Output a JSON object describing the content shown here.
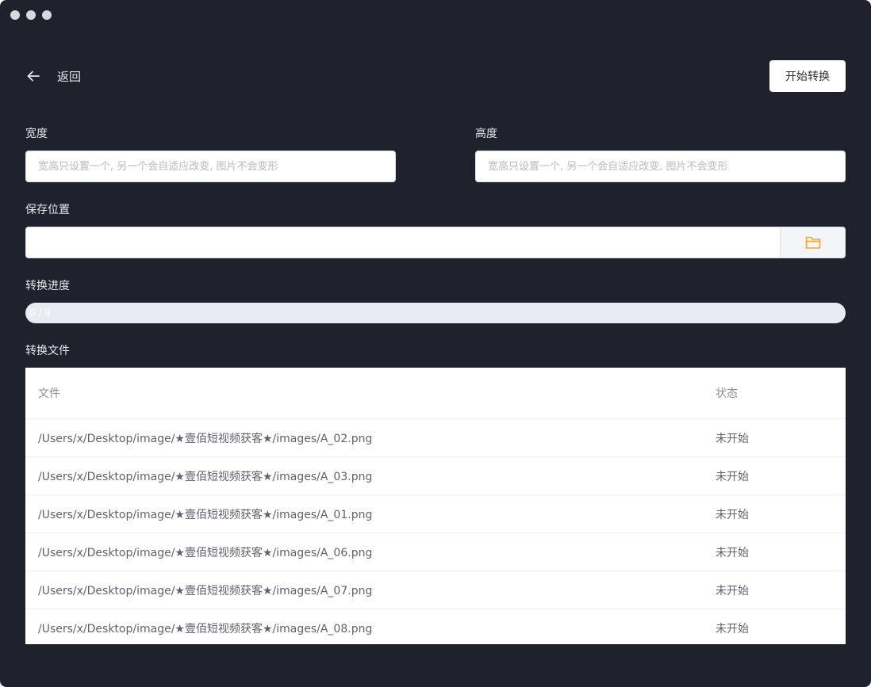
{
  "back": {
    "label": "返回"
  },
  "actions": {
    "start_label": "开始转换"
  },
  "form": {
    "width_label": "宽度",
    "width_placeholder": "宽高只设置一个, 另一个会自适应改变, 图片不会变形",
    "height_label": "高度",
    "height_placeholder": "宽高只设置一个, 另一个会自适应改变, 图片不会变形",
    "save_label": "保存位置",
    "save_value": ""
  },
  "progress": {
    "label": "转换进度",
    "text": "0 / 9",
    "fraction": 0
  },
  "files": {
    "label": "转换文件",
    "columns": [
      "文件",
      "状态"
    ],
    "rows": [
      {
        "file": "/Users/x/Desktop/image/★壹佰短视频获客★/images/A_02.png",
        "status": "未开始"
      },
      {
        "file": "/Users/x/Desktop/image/★壹佰短视频获客★/images/A_03.png",
        "status": "未开始"
      },
      {
        "file": "/Users/x/Desktop/image/★壹佰短视频获客★/images/A_01.png",
        "status": "未开始"
      },
      {
        "file": "/Users/x/Desktop/image/★壹佰短视频获客★/images/A_06.png",
        "status": "未开始"
      },
      {
        "file": "/Users/x/Desktop/image/★壹佰短视频获客★/images/A_07.png",
        "status": "未开始"
      },
      {
        "file": "/Users/x/Desktop/image/★壹佰短视频获客★/images/A_08.png",
        "status": "未开始"
      }
    ]
  },
  "icons": {
    "back": "arrow-left-icon",
    "folder": "folder-icon"
  },
  "colors": {
    "background": "#1f222d",
    "folder_icon": "#f5a623"
  }
}
